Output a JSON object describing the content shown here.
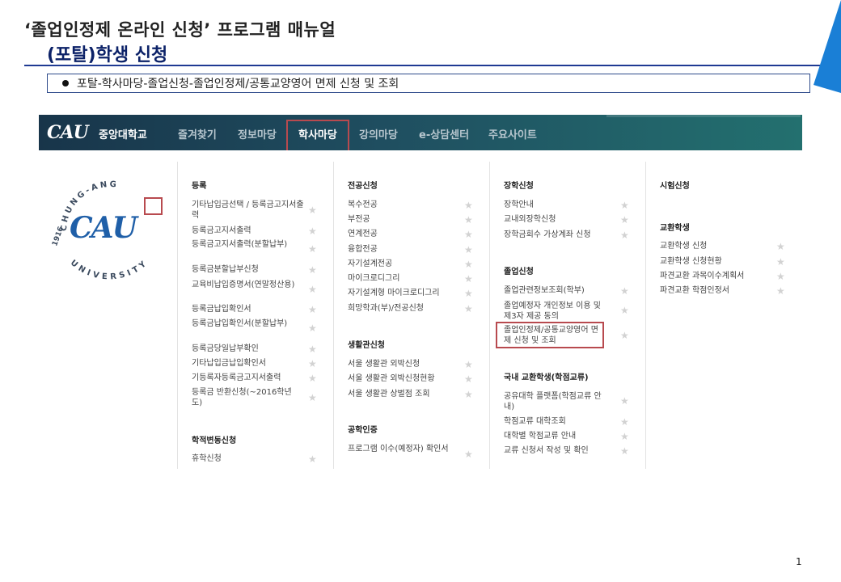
{
  "slide": {
    "title": "‘졸업인정제 온라인 신청’ 프로그램 매뉴얼",
    "subtitle": "(포탈)학생 신청",
    "path": "포탈-학사마당-졸업신청-졸업인정제/공통교양영어 면제 신청 및 조회",
    "page_number": "1"
  },
  "portal": {
    "logo_text": "CAU",
    "university": "중앙대학교",
    "nav": [
      "즐겨찾기",
      "정보마당",
      "학사마당",
      "강의마당",
      "e-상담센터",
      "주요사이트"
    ],
    "active_nav": "학사마당",
    "seal_text_top": "CHUNG-ANG",
    "seal_text_bottom": "UNIVERSITY",
    "seal_year": "1916",
    "seal_logo": "CAU"
  },
  "menu": {
    "col1": {
      "sections": [
        {
          "title": "등록",
          "items": [
            "기타납입금선택 / 등록금고지서출력",
            "등록금고지서출력",
            "등록금고지서출력(분할납부)",
            "등록금분할납부신청",
            "교육비납입증명서(연말정산용)",
            "등록금납입확인서",
            "등록금납입확인서(분할납부)",
            "등록금당일납부확인",
            "기타납입금납입확인서",
            "기등록자등록금고지서출력",
            "등록금 반환신청(~2016학년도)"
          ]
        },
        {
          "title": "학적변동신청",
          "items": [
            "휴학신청"
          ]
        }
      ]
    },
    "col2": {
      "sections": [
        {
          "title": "전공신청",
          "items": [
            "복수전공",
            "부전공",
            "연계전공",
            "융합전공",
            "자기설계전공",
            "마이크로디그리",
            "자기설계형 마이크로디그리",
            "희망학과(부)/전공신청"
          ]
        },
        {
          "title": "생활관신청",
          "items": [
            "서울 생활관 외박신청",
            "서울 생활관 외박신청현황",
            "서울 생활관 상벌점 조회"
          ]
        },
        {
          "title": "공학인증",
          "items": [
            "프로그램 이수(예정자) 확인서"
          ]
        }
      ]
    },
    "col3": {
      "sections": [
        {
          "title": "장학신청",
          "items": [
            "장학안내",
            "교내외장학신청",
            "장학금회수 가상계좌 신청"
          ]
        },
        {
          "title": "졸업신청",
          "items": [
            "졸업관련정보조회(학부)",
            "졸업예정자 개인정보 이용 및 제3자 제공 동의",
            "졸업인정제/공통교양영어 면제 신청 및 조회"
          ]
        },
        {
          "title": "국내 교환학생(학점교류)",
          "items": [
            "공유대학 플랫폼(학점교류 안내)",
            "학점교류 대학조회",
            "대학별 학점교류 안내",
            "교류 신청서 작성 및 확인"
          ]
        }
      ]
    },
    "col4": {
      "sections": [
        {
          "title": "시험신청",
          "items": []
        },
        {
          "title": "교환학생",
          "items": [
            "교환학생 신청",
            "교환학생 신청현황",
            "파견교환 과목이수계획서",
            "파견교환 학점인정서"
          ]
        }
      ]
    },
    "star_symbol": "★"
  },
  "colors": {
    "title_blue": "#0c2268",
    "nav_start": "#18354a",
    "nav_end": "#23706f",
    "highlight_red": "#b84a4f",
    "accent_triangle": "#1a7fd6"
  }
}
